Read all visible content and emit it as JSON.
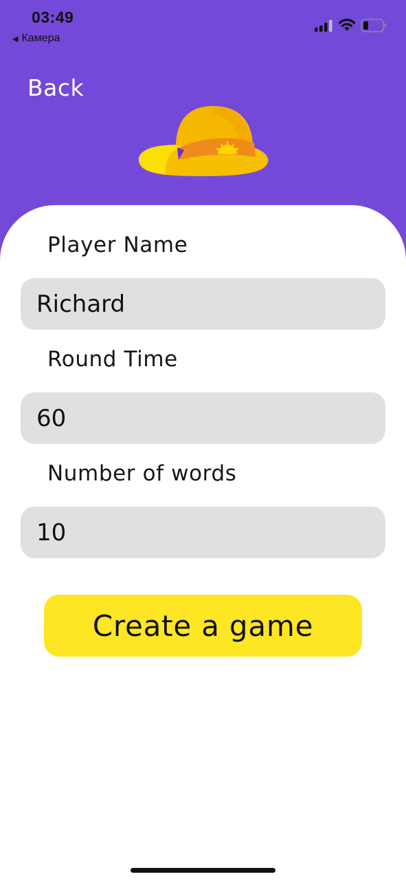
{
  "status_bar": {
    "time": "03:49",
    "back_app": "Камера",
    "back_icon": "triangle-left-icon",
    "signal_icon": "cellular-signal-icon",
    "wifi_icon": "wifi-icon",
    "battery_icon": "battery-low-icon"
  },
  "header": {
    "back_label": "Back",
    "logo_icon": "hat-icon",
    "background_color": "#7449d9"
  },
  "form": {
    "player_name": {
      "label": "Player Name",
      "value": "Richard"
    },
    "round_time": {
      "label": "Round Time",
      "value": "60"
    },
    "number_of_words": {
      "label": "Number of words",
      "value": "10"
    }
  },
  "actions": {
    "create_label": "Create a game",
    "create_color": "#fde623"
  }
}
